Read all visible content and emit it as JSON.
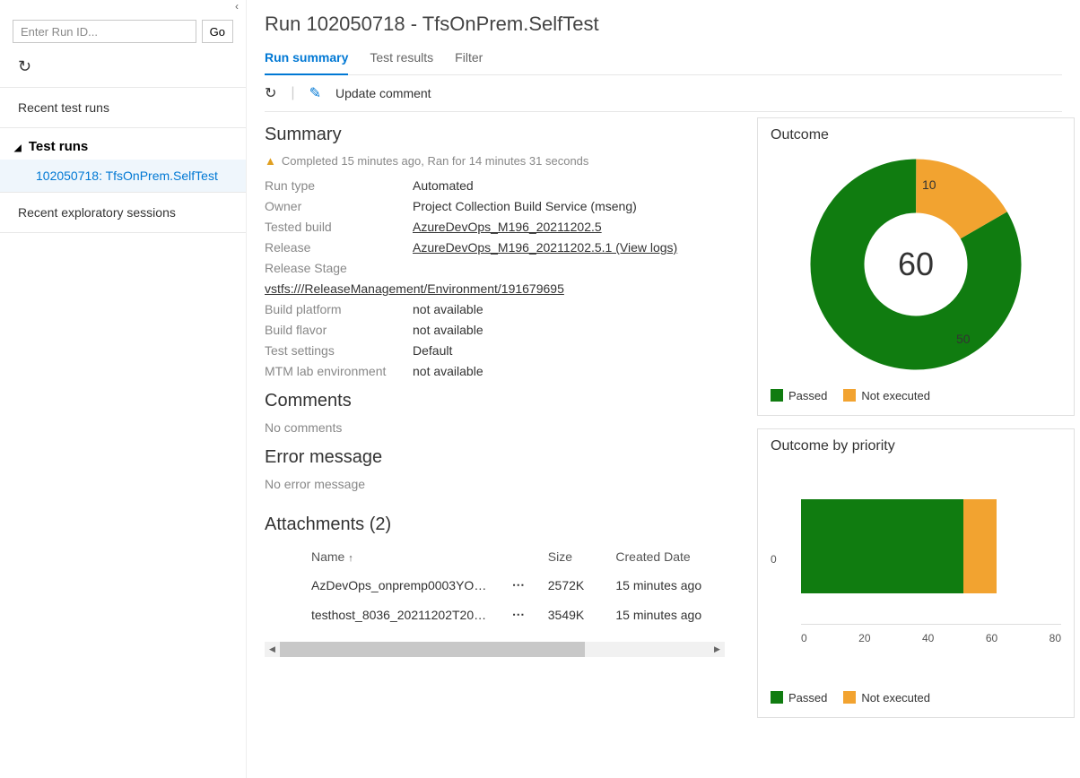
{
  "colors": {
    "passed": "#107c10",
    "not_executed": "#f2a330",
    "accent": "#0078d4"
  },
  "sidebar": {
    "search_placeholder": "Enter Run ID...",
    "go_label": "Go",
    "sections": {
      "recent_runs": "Recent test runs",
      "test_runs_header": "Test runs",
      "selected_run": "102050718: TfsOnPrem.SelfTest",
      "recent_exploratory": "Recent exploratory sessions"
    }
  },
  "header": {
    "title": "Run 102050718 - TfsOnPrem.SelfTest"
  },
  "tabs": [
    {
      "id": "summary",
      "label": "Run summary",
      "active": true
    },
    {
      "id": "results",
      "label": "Test results",
      "active": false
    },
    {
      "id": "filter",
      "label": "Filter",
      "active": false
    }
  ],
  "toolbar": {
    "update_comment": "Update comment"
  },
  "summary": {
    "heading": "Summary",
    "status": "Completed 15 minutes ago, Ran for 14 minutes 31 seconds",
    "fields": {
      "run_type": {
        "label": "Run type",
        "value": "Automated"
      },
      "owner": {
        "label": "Owner",
        "value": "Project Collection Build Service (mseng)"
      },
      "tested_build": {
        "label": "Tested build",
        "value": "AzureDevOps_M196_20211202.5",
        "link": true
      },
      "release": {
        "label": "Release",
        "value": "AzureDevOps_M196_20211202.5.1 (View logs)",
        "link": true
      },
      "release_stage": {
        "label": "Release Stage",
        "value": "vstfs:///ReleaseManagement/Environment/191679695",
        "link": true,
        "stacked": true
      },
      "build_platform": {
        "label": "Build platform",
        "value": "not available"
      },
      "build_flavor": {
        "label": "Build flavor",
        "value": "not available"
      },
      "test_settings": {
        "label": "Test settings",
        "value": "Default"
      },
      "mtm_lab": {
        "label": "MTM lab environment",
        "value": "not available"
      }
    },
    "comments": {
      "heading": "Comments",
      "value": "No comments"
    },
    "error": {
      "heading": "Error message",
      "value": "No error message"
    },
    "attachments": {
      "heading": "Attachments (2)",
      "columns": {
        "name": "Name",
        "size": "Size",
        "created": "Created Date"
      },
      "rows": [
        {
          "name": "AzDevOps_onpremp0003YO…",
          "size": "2572K",
          "created": "15 minutes ago"
        },
        {
          "name": "testhost_8036_20211202T20…",
          "size": "3549K",
          "created": "15 minutes ago"
        }
      ]
    }
  },
  "outcome_card": {
    "heading": "Outcome",
    "total": "60",
    "legend": {
      "passed": "Passed",
      "not_executed": "Not executed"
    }
  },
  "priority_card": {
    "heading": "Outcome by priority",
    "y_label": "0",
    "x_ticks": [
      "0",
      "20",
      "40",
      "60",
      "80"
    ],
    "legend": {
      "passed": "Passed",
      "not_executed": "Not executed"
    }
  },
  "chart_data": [
    {
      "type": "pie",
      "title": "Outcome",
      "series": [
        {
          "name": "Passed",
          "value": 50,
          "color": "#107c10"
        },
        {
          "name": "Not executed",
          "value": 10,
          "color": "#f2a330"
        }
      ],
      "total": 60,
      "data_labels": {
        "Passed": 50,
        "Not executed": 10
      }
    },
    {
      "type": "bar",
      "orientation": "horizontal",
      "title": "Outcome by priority",
      "categories": [
        "0"
      ],
      "series": [
        {
          "name": "Passed",
          "values": [
            50
          ],
          "color": "#107c10"
        },
        {
          "name": "Not executed",
          "values": [
            10
          ],
          "color": "#f2a330"
        }
      ],
      "xlabel": "",
      "ylabel": "",
      "xlim": [
        0,
        80
      ],
      "x_ticks": [
        0,
        20,
        40,
        60,
        80
      ],
      "stacked": true
    }
  ]
}
